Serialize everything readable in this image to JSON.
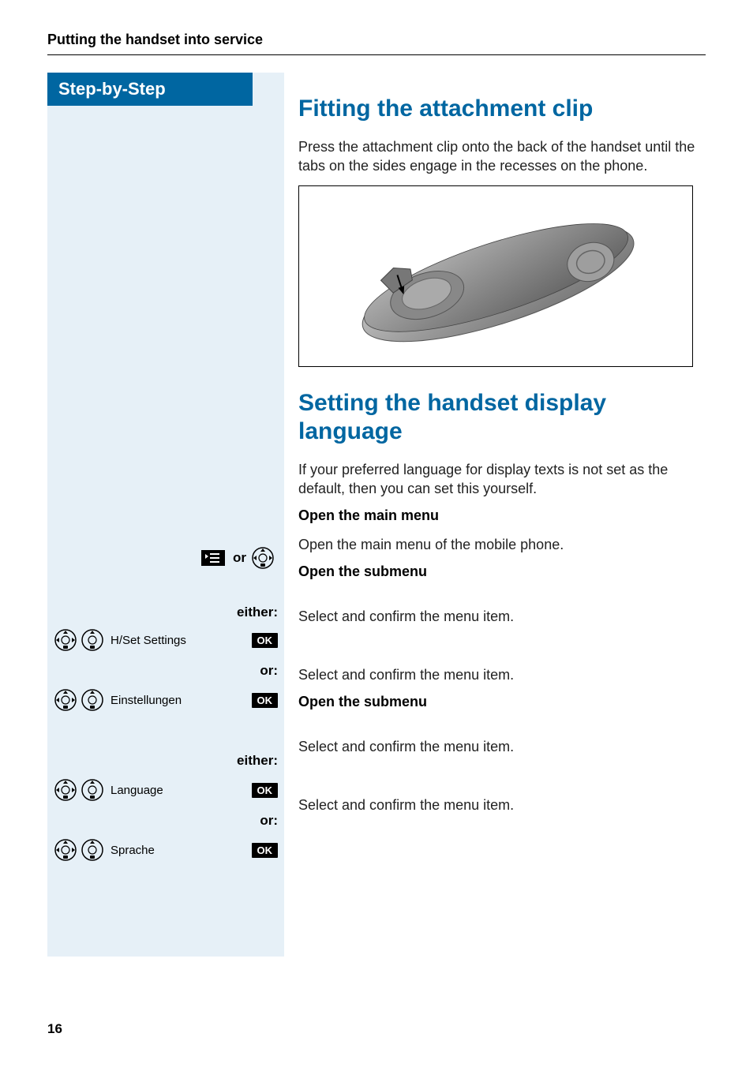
{
  "header": {
    "title": "Putting the handset into service"
  },
  "sidebar": {
    "title": "Step-by-Step"
  },
  "sections": {
    "clip": {
      "heading": "Fitting the attachment clip",
      "body": "Press the attachment clip onto the back of the handset until the tabs on the sides engage in the recesses on the phone."
    },
    "language": {
      "heading": "Setting the handset display language",
      "body": "If your preferred language for display texts is not set as the default, then you can set this yourself.",
      "open_main_heading": "Open the main menu",
      "open_main_text": "Open the main menu of the mobile phone.",
      "open_sub_heading": "Open the submenu",
      "either": "either:",
      "or": "or:",
      "or_word": "or",
      "ok": "OK",
      "items": {
        "hset": "H/Set Settings",
        "einst": "Einstellungen",
        "lang": "Language",
        "sprache": "Sprache"
      },
      "select_confirm": "Select and confirm the menu item.",
      "open_sub_heading2": "Open the submenu"
    }
  },
  "page_number": "16"
}
